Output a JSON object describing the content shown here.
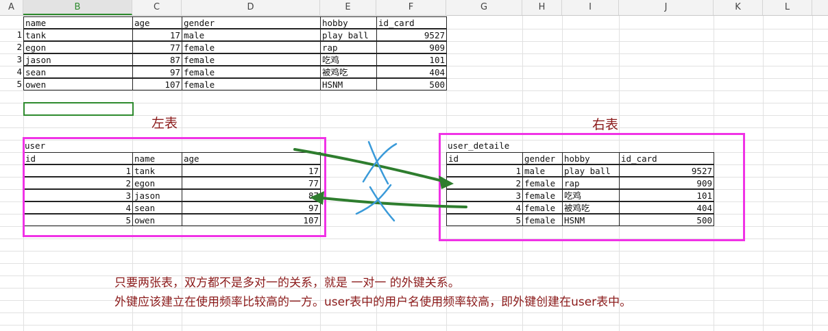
{
  "columns": [
    "A",
    "B",
    "C",
    "D",
    "E",
    "F",
    "G",
    "H",
    "I",
    "J",
    "K",
    "L"
  ],
  "selected_column": "B",
  "top_table": {
    "headers": [
      "name",
      "age",
      "gender",
      "hobby",
      "id_card"
    ],
    "rows": [
      {
        "n": "1",
        "name": "tank",
        "age": "17",
        "gender": "male",
        "hobby": "play ball",
        "id_card": "9527"
      },
      {
        "n": "2",
        "name": "egon",
        "age": "77",
        "gender": "female",
        "hobby": "rap",
        "id_card": "909"
      },
      {
        "n": "3",
        "name": "jason",
        "age": "87",
        "gender": "female",
        "hobby": "吃鸡",
        "id_card": "101"
      },
      {
        "n": "4",
        "name": "sean",
        "age": "97",
        "gender": "female",
        "hobby": "被鸡吃",
        "id_card": "404"
      },
      {
        "n": "5",
        "name": "owen",
        "age": "107",
        "gender": "female",
        "hobby": "HSNM",
        "id_card": "500"
      }
    ]
  },
  "left_caption": "左表",
  "right_caption": "右表",
  "user_table": {
    "title": "user",
    "headers": [
      "id",
      "name",
      "age"
    ],
    "rows": [
      {
        "id": "1",
        "name": "tank",
        "age": "17"
      },
      {
        "id": "2",
        "name": "egon",
        "age": "77"
      },
      {
        "id": "3",
        "name": "jason",
        "age": "87"
      },
      {
        "id": "4",
        "name": "sean",
        "age": "97"
      },
      {
        "id": "5",
        "name": "owen",
        "age": "107"
      }
    ]
  },
  "detail_table": {
    "title": "user_detaile",
    "headers": [
      "id",
      "gender",
      "hobby",
      "id_card"
    ],
    "rows": [
      {
        "id": "1",
        "gender": "male",
        "hobby": "play ball",
        "id_card": "9527"
      },
      {
        "id": "2",
        "gender": "female",
        "hobby": "rap",
        "id_card": "909"
      },
      {
        "id": "3",
        "gender": "female",
        "hobby": "吃鸡",
        "id_card": "101"
      },
      {
        "id": "4",
        "gender": "female",
        "hobby": "被鸡吃",
        "id_card": "404"
      },
      {
        "id": "5",
        "gender": "female",
        "hobby": "HSNM",
        "id_card": "500"
      }
    ]
  },
  "notes": [
    "只要两张表，双方都不是多对一的关系，就是 一对一 的外键关系。",
    "外键应该建立在使用频率比较高的一方。user表中的用户名使用频率较高，即外键创建在user表中。"
  ],
  "colors": {
    "caption": "#8b1a1a",
    "frame": "#f032e6",
    "arrow": "#2e7d2e",
    "cross": "#3a9ad9",
    "selection": "#2d8a2d"
  }
}
